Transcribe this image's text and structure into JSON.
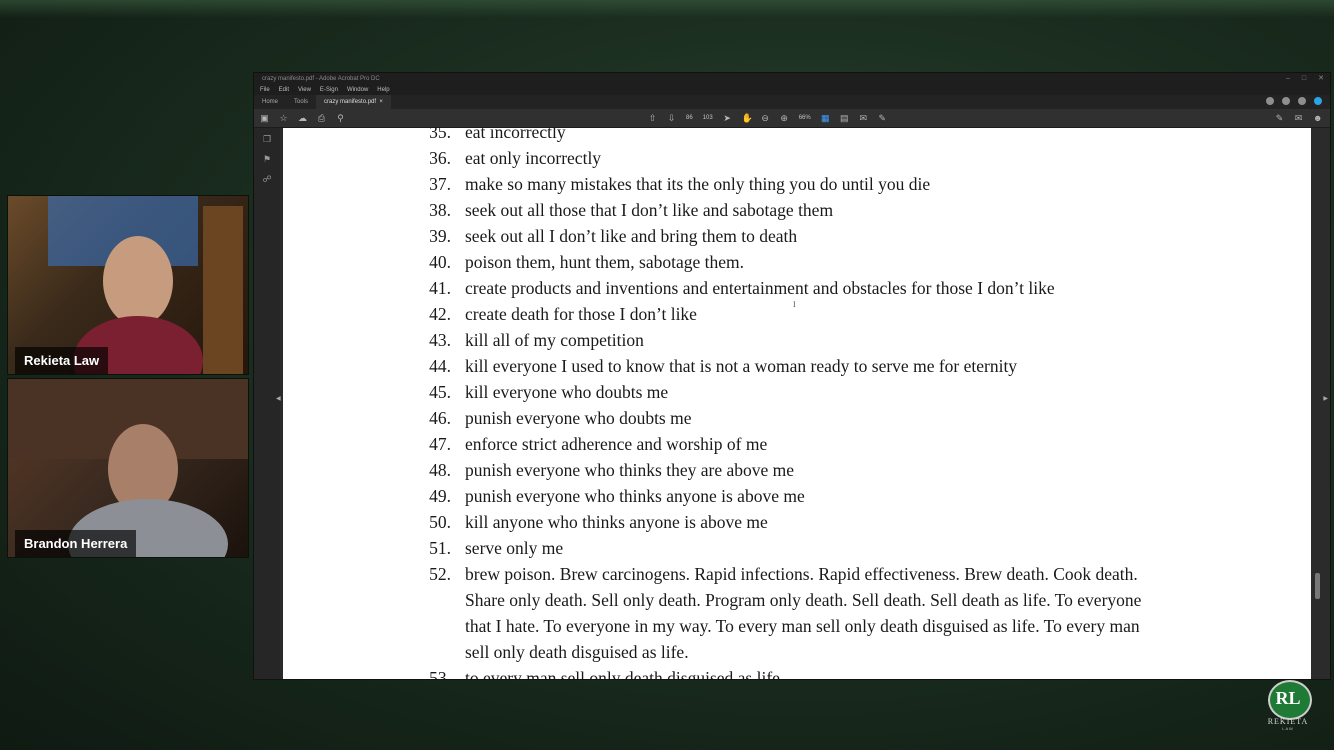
{
  "stream": {
    "cams": [
      {
        "name": "Rekieta Law"
      },
      {
        "name": "Brandon Herrera"
      }
    ],
    "logo": {
      "monogram": "RL",
      "name": "REKIETA",
      "sub": "LAW"
    }
  },
  "app": {
    "title": "crazy manifesto.pdf - Adobe Acrobat Pro DC",
    "menu": [
      "File",
      "Edit",
      "View",
      "E-Sign",
      "Window",
      "Help"
    ],
    "tabs": [
      {
        "label": "Home"
      },
      {
        "label": "Tools"
      },
      {
        "label": "crazy manifesto.pdf"
      }
    ],
    "zoom": "66%",
    "page_num": "86",
    "page_total": "103"
  },
  "document": {
    "items": [
      {
        "num": "35.",
        "text": "eat incorrectly"
      },
      {
        "num": "36.",
        "text": "eat only incorrectly"
      },
      {
        "num": "37.",
        "text": "make so many mistakes that its the only thing you do until you die"
      },
      {
        "num": "38.",
        "text": "seek out all those that I don’t like and sabotage them"
      },
      {
        "num": "39.",
        "text": "seek out all I don’t like and bring them to death"
      },
      {
        "num": "40.",
        "text": "poison them, hunt them, sabotage them."
      },
      {
        "num": "41.",
        "text": "create products and inventions and entertainment and obstacles for those I don’t like"
      },
      {
        "num": "42.",
        "text": "create death for those I don’t like"
      },
      {
        "num": "43.",
        "text": "kill all of my competition"
      },
      {
        "num": "44.",
        "text": "kill everyone I used to know that is not a woman ready to serve me for eternity"
      },
      {
        "num": "45.",
        "text": "kill everyone who doubts me"
      },
      {
        "num": "46.",
        "text": "punish everyone who doubts me"
      },
      {
        "num": "47.",
        "text": "enforce strict adherence and worship of me"
      },
      {
        "num": "48.",
        "text": "punish everyone who thinks they are above me"
      },
      {
        "num": "49.",
        "text": "punish everyone who thinks anyone is above me"
      },
      {
        "num": "50.",
        "text": "kill anyone who thinks anyone is above me"
      },
      {
        "num": "51.",
        "text": "serve only me"
      }
    ],
    "item52": {
      "num": "52.",
      "lines": [
        "brew poison. Brew carcinogens. Rapid infections. Rapid effectiveness. Brew death. Cook death.",
        "Share only death. Sell only death. Program only death. Sell death. Sell death as life. To everyone",
        "that I hate. To everyone in my way. To every man sell only death disguised as life. To every man",
        "sell only death disguised as life."
      ]
    },
    "item53": {
      "num": "53.",
      "text": "to every man sell only death disguised as life"
    }
  }
}
